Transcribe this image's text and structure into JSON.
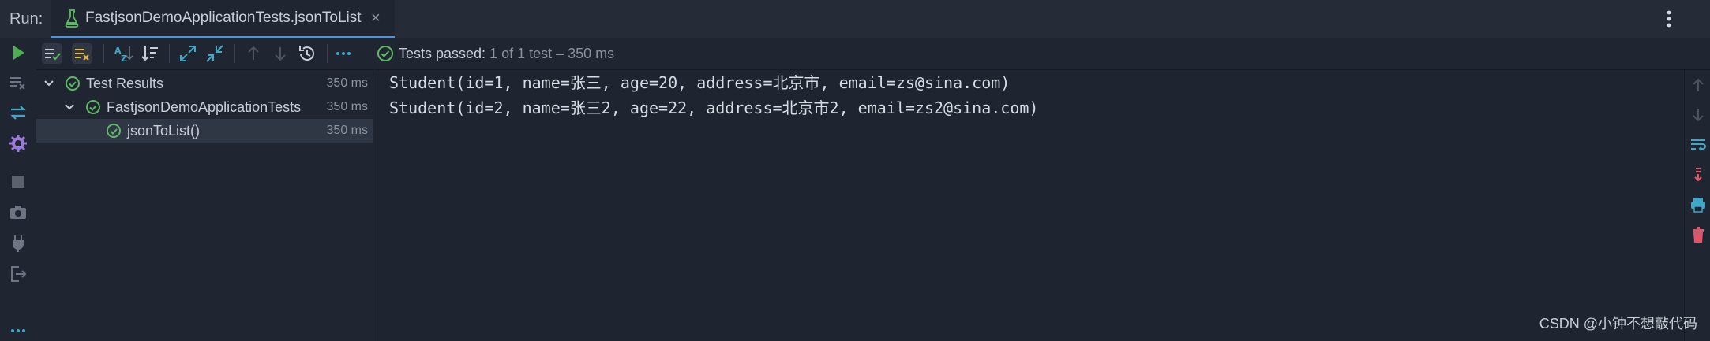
{
  "topbar": {
    "run_label": "Run:",
    "tab_title": "FastjsonDemoApplicationTests.jsonToList",
    "tab_close": "×"
  },
  "toolbar": {
    "status_passed": "Tests passed:",
    "status_rest": "1 of 1 test – 350 ms"
  },
  "tree": {
    "rows": [
      {
        "label": "Test Results",
        "time": "350 ms"
      },
      {
        "label": "FastjsonDemoApplicationTests",
        "time": "350 ms"
      },
      {
        "label": "jsonToList()",
        "time": "350 ms"
      }
    ]
  },
  "console": {
    "lines": [
      "Student(id=1, name=张三, age=20, address=北京市, email=zs@sina.com)",
      "Student(id=2, name=张三2, age=22, address=北京市2, email=zs2@sina.com)"
    ]
  },
  "watermark": "CSDN @小钟不想敲代码",
  "colors": {
    "pass_green": "#5fb865",
    "accent_blue": "#4f94d4",
    "run_green": "#4caf50",
    "clear_red": "#e0556a",
    "print_cyan": "#3fa7c7"
  },
  "icons": {
    "tab": "test-flask-icon",
    "rerun": "run-icon",
    "pass": "check-circle-icon"
  }
}
